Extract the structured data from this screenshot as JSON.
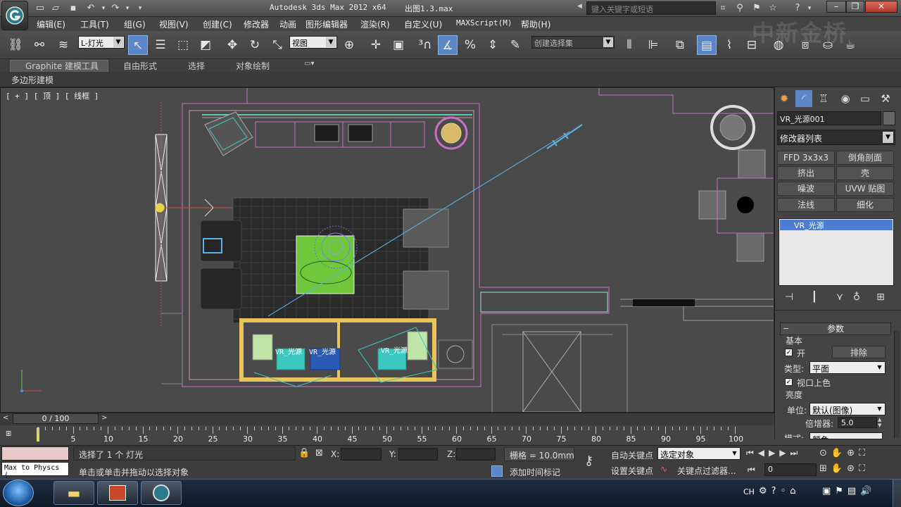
{
  "window": {
    "title": "Autodesk 3ds Max  2012 x64",
    "doc_name": "出图1.3.max",
    "search_placeholder": "键入关键字或短语",
    "watermark": "中新金桥"
  },
  "menu": [
    "编辑(E)",
    "工具(T)",
    "组(G)",
    "视图(V)",
    "创建(C)",
    "修改器",
    "动画",
    "图形编辑器",
    "渲染(R)",
    "自定义(U)",
    "MAXScript(M)",
    "帮助(H)"
  ],
  "toolbar": {
    "selection_filter": "L-灯光",
    "ref_coord": "视图",
    "named_selection": "创建选择集"
  },
  "ribbon": {
    "tabs": [
      "Graphite 建模工具",
      "自由形式",
      "选择",
      "对象绘制"
    ],
    "sub_label": "多边形建模"
  },
  "viewport": {
    "label": "[ + ] [ 顶 ] [ 线框 ]",
    "light_labels": [
      "VR_光源",
      "VR_光源",
      "VR_光源"
    ]
  },
  "command_panel": {
    "object_name": "VR_光源001",
    "modifier_list": "修改器列表",
    "modifier_buttons": [
      "FFD 3x3x3",
      "倒角剖面",
      "挤出",
      "壳",
      "噪波",
      "UVW 贴图",
      "法线",
      "细化"
    ],
    "stack_item": "VR_光源",
    "rollout_title": "参数",
    "group_basic": "基本",
    "on_label": "开",
    "exclude_label": "排除",
    "type_label": "类型:",
    "type_value": "平面",
    "viewport_color_label": "视口上色",
    "group_intensity": "亮度",
    "units_label": "单位:",
    "units_value": "默认(图像)",
    "multiplier_label": "倍增器:",
    "multiplier_value": "5.0",
    "mode_label": "模式:",
    "mode_value": "颜色"
  },
  "timeline": {
    "thumb": "0 / 100",
    "ticks": [
      "5",
      "10",
      "15",
      "20",
      "25",
      "30",
      "35",
      "40",
      "45",
      "50",
      "55",
      "60",
      "65",
      "70",
      "75",
      "80",
      "85",
      "90",
      "95",
      "100"
    ]
  },
  "status": {
    "listener": "Max to Physcs (",
    "selected_msg": "选择了 1 个 灯光",
    "prompt_msg": "单击或单击并拖动以选择对象",
    "x_label": "X:",
    "y_label": "Y:",
    "z_label": "Z:",
    "grid": "栅格 = 10.0mm",
    "add_time_tag": "添加时间标记",
    "auto_key": "自动关键点",
    "set_key": "设置关键点",
    "key_mode": "选定对象",
    "key_filters": "关键点过滤器...",
    "frame": "0"
  },
  "taskbar": {
    "lang": "CH"
  },
  "colors": {
    "accent": "#5b86c8",
    "viewport_bg": "#4a4a4a",
    "selection_blue": "#4d7cd0"
  }
}
